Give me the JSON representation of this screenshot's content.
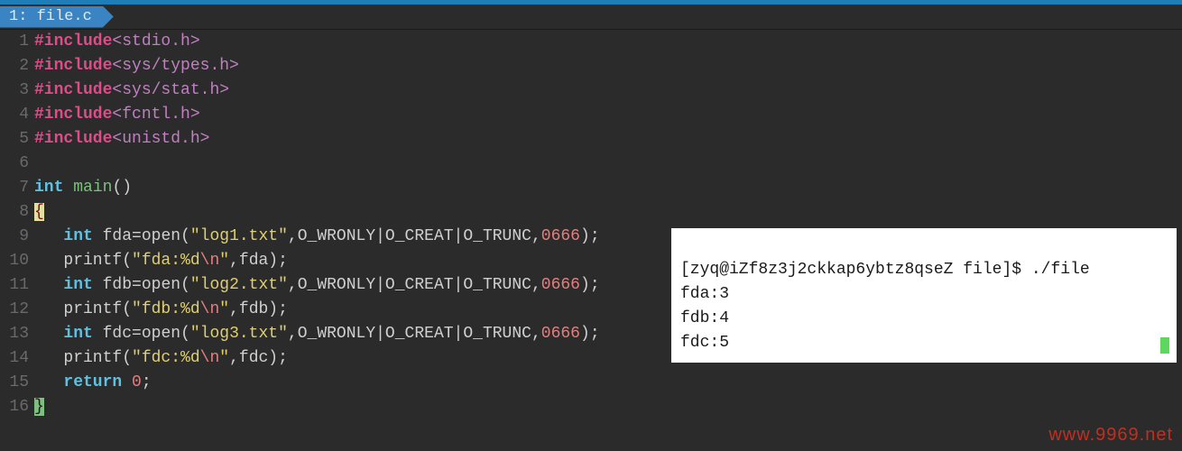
{
  "tab": {
    "index": "1:",
    "filename": "file.c"
  },
  "gutter": [
    "1",
    "2",
    "3",
    "4",
    "5",
    "6",
    "7",
    "8",
    "9",
    "10",
    "11",
    "12",
    "13",
    "14",
    "15",
    "16"
  ],
  "code": {
    "includes": [
      {
        "directive": "#include",
        "path": "<stdio.h>"
      },
      {
        "directive": "#include",
        "path": "<sys/types.h>"
      },
      {
        "directive": "#include",
        "path": "<sys/stat.h>"
      },
      {
        "directive": "#include",
        "path": "<fcntl.h>"
      },
      {
        "directive": "#include",
        "path": "<unistd.h>"
      }
    ],
    "main_sig": {
      "type": "int",
      "name": "main",
      "params": "()"
    },
    "open_brace": "{",
    "body": [
      {
        "type": "int",
        "var": "fda",
        "eq": "=",
        "call": "open",
        "lp": "(",
        "str": "\"log1.txt\"",
        "c1": ",",
        "flags": "O_WRONLY|O_CREAT|O_TRUNC",
        "c2": ",",
        "mode": "0666",
        "rp": ")",
        "semi": ";"
      },
      {
        "call": "printf",
        "lp": "(",
        "str_a": "\"fda:%d",
        "esc": "\\n",
        "str_b": "\"",
        "c1": ",",
        "arg": "fda",
        "rp": ")",
        "semi": ";"
      },
      {
        "type": "int",
        "var": "fdb",
        "eq": "=",
        "call": "open",
        "lp": "(",
        "str": "\"log2.txt\"",
        "c1": ",",
        "flags": "O_WRONLY|O_CREAT|O_TRUNC",
        "c2": ",",
        "mode": "0666",
        "rp": ")",
        "semi": ";"
      },
      {
        "call": "printf",
        "lp": "(",
        "str_a": "\"fdb:%d",
        "esc": "\\n",
        "str_b": "\"",
        "c1": ",",
        "arg": "fdb",
        "rp": ")",
        "semi": ";"
      },
      {
        "type": "int",
        "var": "fdc",
        "eq": "=",
        "call": "open",
        "lp": "(",
        "str": "\"log3.txt\"",
        "c1": ",",
        "flags": "O_WRONLY|O_CREAT|O_TRUNC",
        "c2": ",",
        "mode": "0666",
        "rp": ")",
        "semi": ";"
      },
      {
        "call": "printf",
        "lp": "(",
        "str_a": "\"fdc:%d",
        "esc": "\\n",
        "str_b": "\"",
        "c1": ",",
        "arg": "fdc",
        "rp": ")",
        "semi": ";"
      }
    ],
    "return": {
      "kw": "return",
      "val": "0",
      "semi": ";"
    },
    "close_brace": "}"
  },
  "terminal": {
    "prompt": "[zyq@iZf8z3j2ckkap6ybtz8qseZ file]$ ",
    "command": "./file",
    "output": [
      "fda:3",
      "fdb:4",
      "fdc:5"
    ]
  },
  "watermark": "www.9969.net"
}
